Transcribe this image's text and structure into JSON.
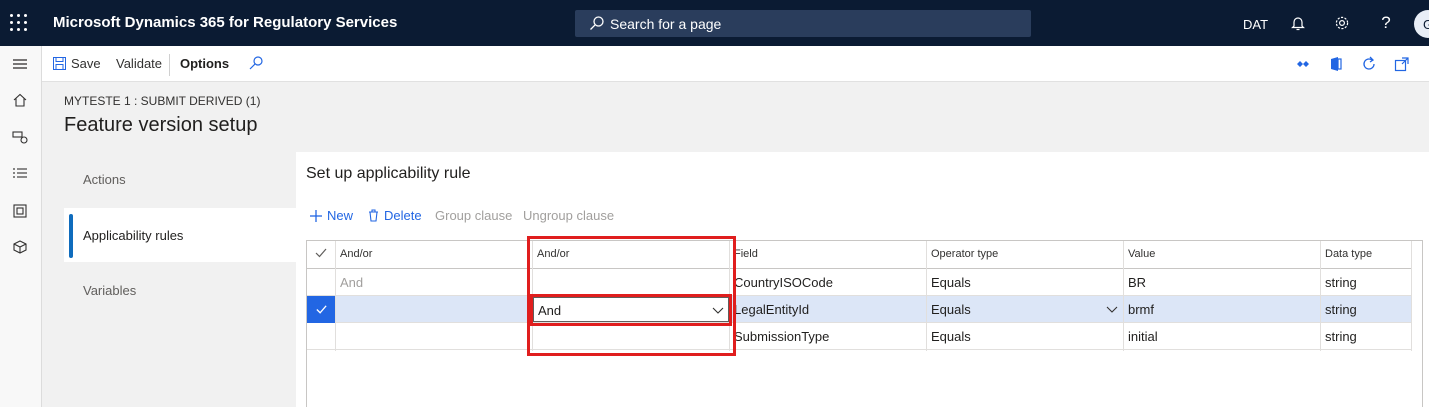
{
  "topbar": {
    "app_title": "Microsoft Dynamics 365 for Regulatory Services",
    "search_placeholder": "Search for a page",
    "company": "DAT",
    "avatar_initial": "G",
    "icons": [
      "waffle-icon",
      "search-icon",
      "bell-icon",
      "gear-icon",
      "help-icon"
    ]
  },
  "rail": {
    "icons": [
      "hamburger-icon",
      "home-icon",
      "favorites-icon",
      "recent-icon",
      "workspaces-icon",
      "modules-icon"
    ]
  },
  "actionbar": {
    "save_label": "Save",
    "validate_label": "Validate",
    "options_label": "Options",
    "right_icons": [
      "connect-icon",
      "office-icon",
      "refresh-icon",
      "popout-icon"
    ]
  },
  "page": {
    "breadcrumb": "MYTESTE 1 : SUBMIT DERIVED (1)",
    "title": "Feature version setup"
  },
  "vtabs": [
    {
      "label": "Actions",
      "active": false
    },
    {
      "label": "Applicability rules",
      "active": true
    },
    {
      "label": "Variables",
      "active": false
    }
  ],
  "section": {
    "title": "Set up applicability rule",
    "toolbar": {
      "new_label": "New",
      "delete_label": "Delete",
      "group_label": "Group clause",
      "ungroup_label": "Ungroup clause"
    }
  },
  "grid": {
    "columns": [
      "And/or",
      "And/or",
      "Field",
      "Operator type",
      "Value",
      "Data type"
    ],
    "rows": [
      {
        "and_or": "And",
        "and_or2": "",
        "field": "CountryISOCode",
        "operator": "Equals",
        "value": "BR",
        "data_type": "string",
        "selected": false
      },
      {
        "and_or": "",
        "and_or2": "And",
        "field": "LegalEntityId",
        "operator": "Equals",
        "value": "brmf",
        "data_type": "string",
        "selected": true
      },
      {
        "and_or": "",
        "and_or2": "",
        "field": "SubmissionType",
        "operator": "Equals",
        "value": "initial",
        "data_type": "string",
        "selected": false
      }
    ]
  },
  "colors": {
    "topbar": "#0b1b33",
    "accent": "#2266e3",
    "selected_row": "#dce6f7",
    "highlight": "#e01e1e"
  }
}
